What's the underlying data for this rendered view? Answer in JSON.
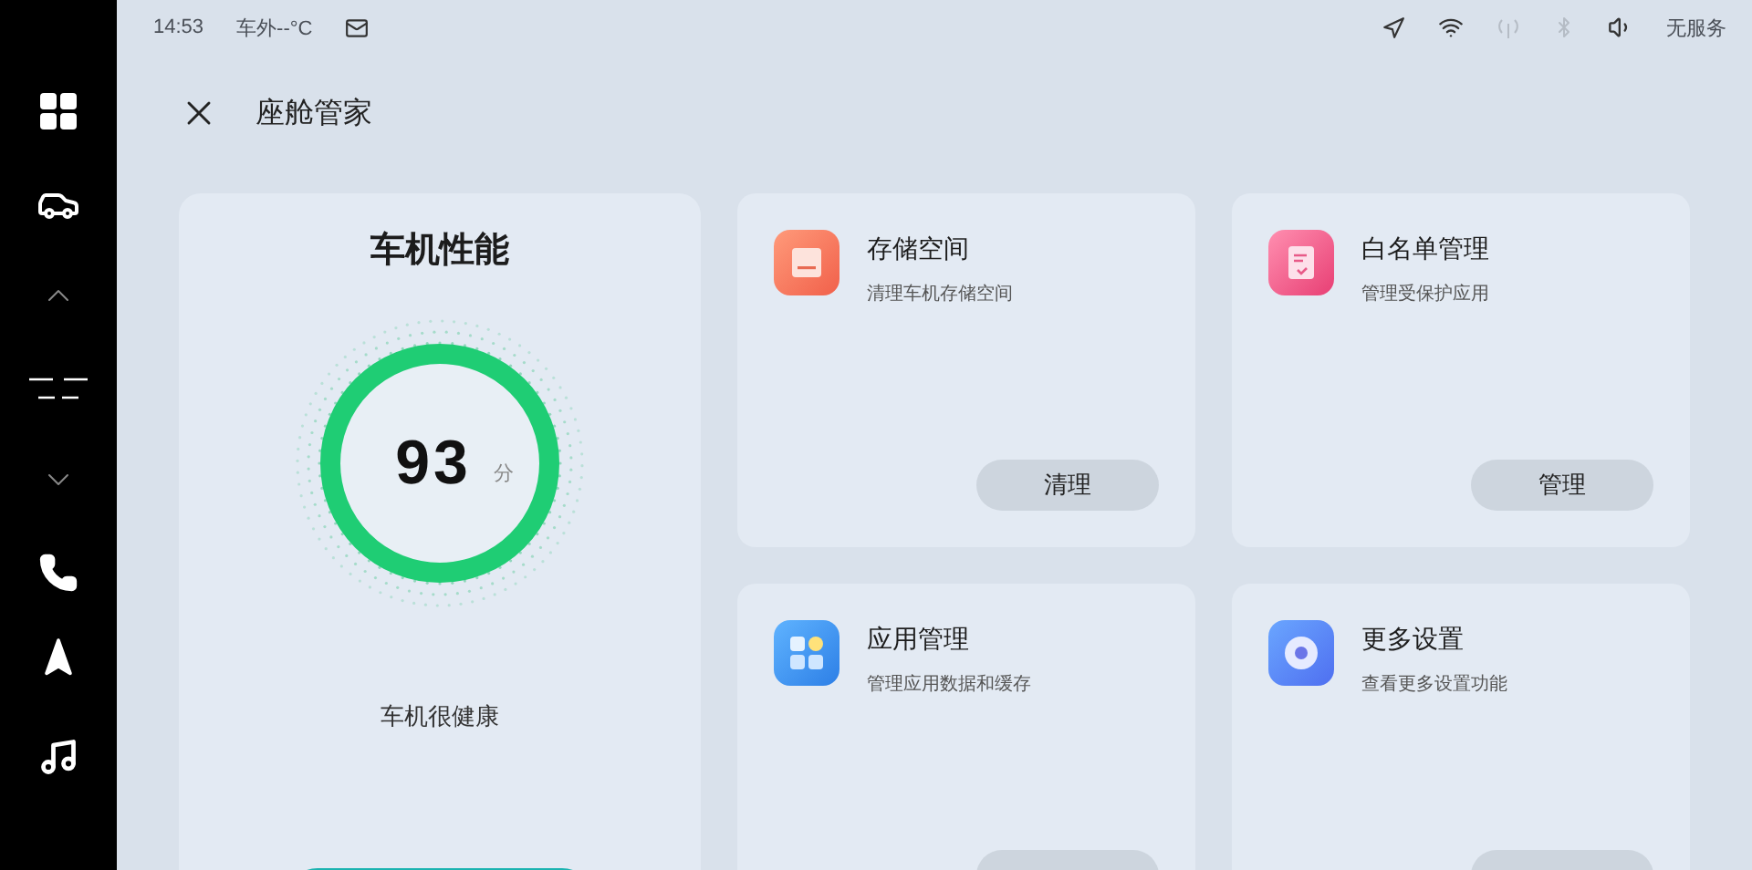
{
  "status_bar": {
    "time": "14:53",
    "outside_temp": "车外--°C",
    "network": "无服务"
  },
  "header": {
    "title": "座舱管家"
  },
  "performance": {
    "title": "车机性能",
    "score": "93",
    "unit": "分",
    "status": "车机很健康"
  },
  "tools": [
    {
      "title": "存储空间",
      "subtitle": "清理车机存储空间",
      "action": "清理"
    },
    {
      "title": "白名单管理",
      "subtitle": "管理受保护应用",
      "action": "管理"
    },
    {
      "title": "应用管理",
      "subtitle": "管理应用数据和缓存"
    },
    {
      "title": "更多设置",
      "subtitle": "查看更多设置功能"
    }
  ]
}
